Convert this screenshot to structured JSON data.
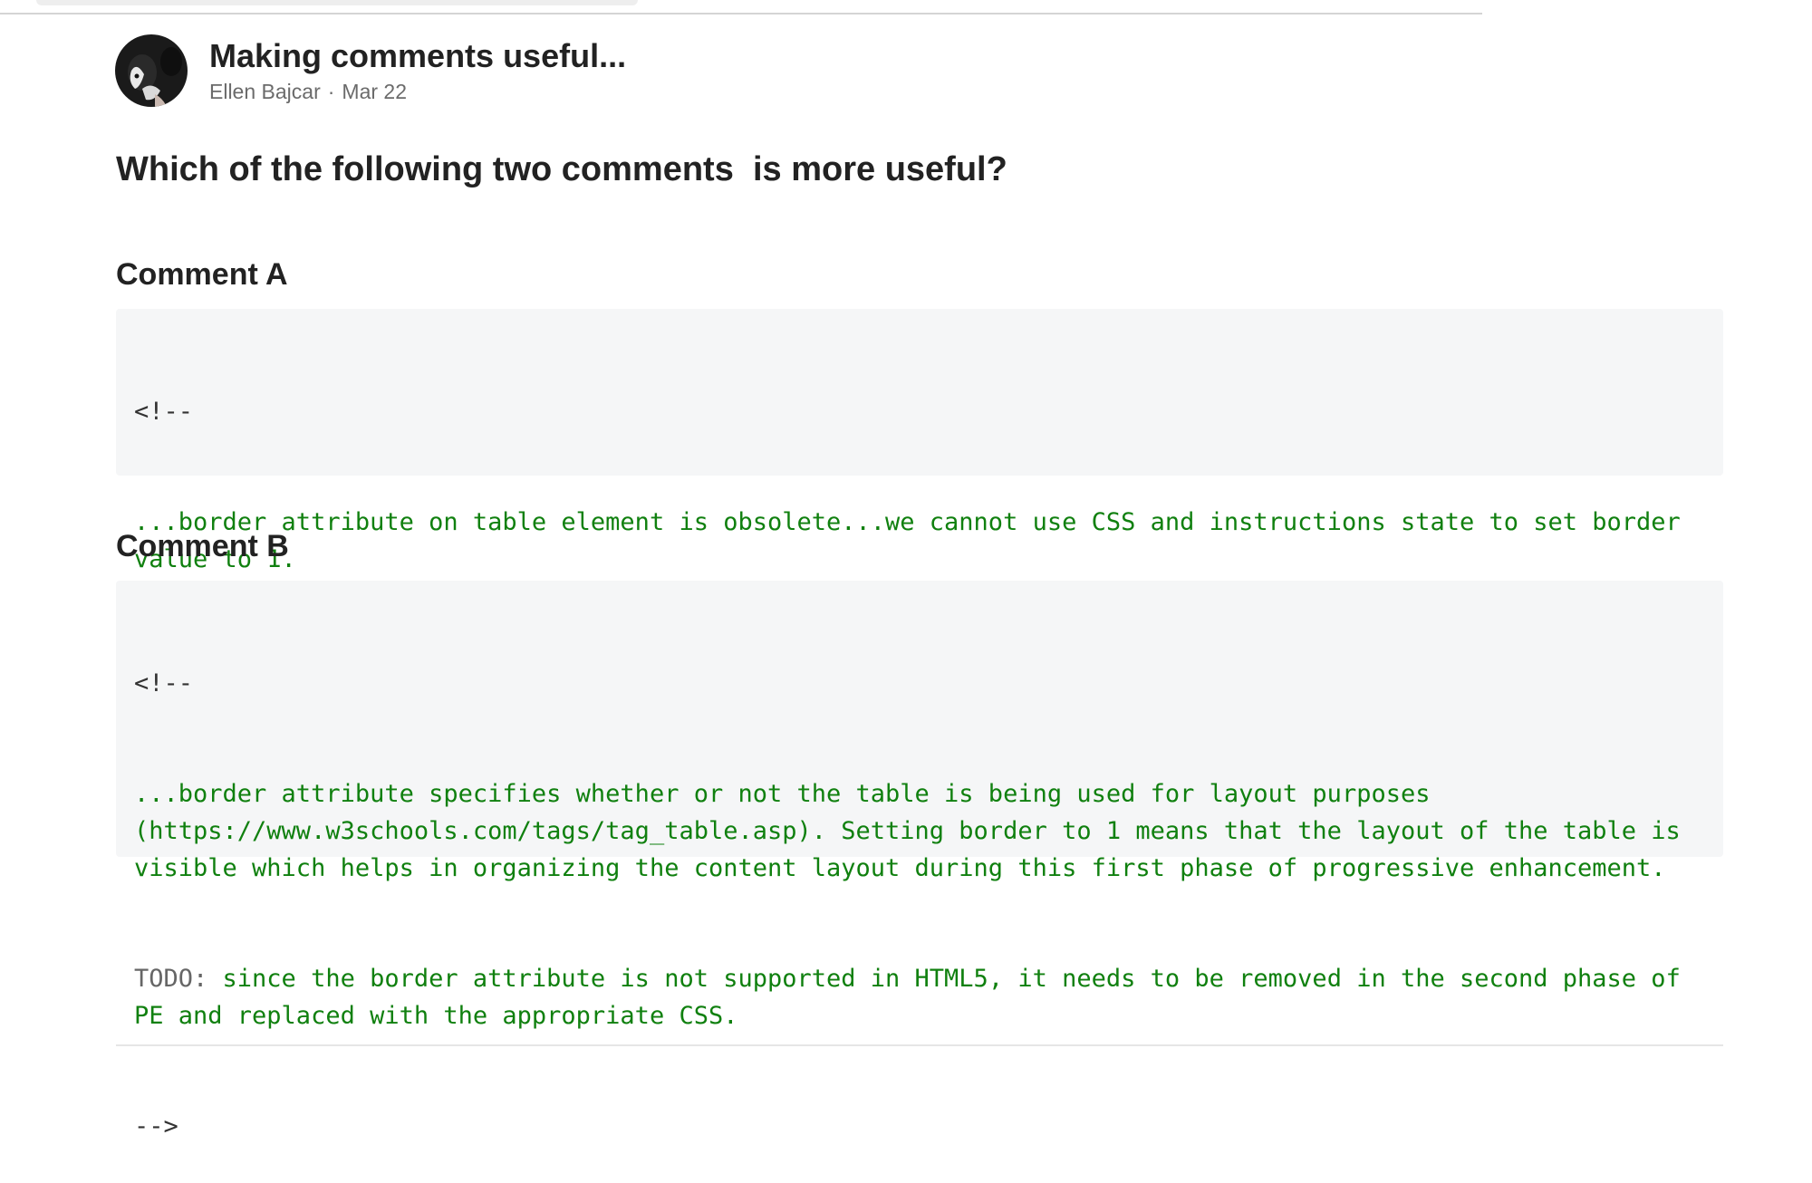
{
  "post": {
    "title": "Making comments useful...",
    "author": "Ellen Bajcar",
    "separator": "·",
    "date": "Mar 22",
    "question": "Which of the following two comments  is more useful?"
  },
  "comment_a": {
    "heading": "Comment A",
    "open": "<!--",
    "body": "...border attribute on table element is obsolete...we cannot use CSS and instructions state to set border value to 1.",
    "close": "-->"
  },
  "comment_b": {
    "heading": "Comment B",
    "open": "<!--",
    "body_1": "...border attribute specifies whether or not the table is being used for layout purposes (https://www.w3schools.com/tags/tag_table.asp). Setting border to 1 means that the layout of the table is visible which helps in organizing the content layout during this first phase of progressive enhancement.",
    "todo_label": "TODO:",
    "body_2": " since the border attribute is not supported in HTML5, it needs to be removed in the second phase of PE and replaced with the appropriate CSS.",
    "close": "-->"
  },
  "colors": {
    "code_green": "#10800f",
    "code_background": "#f5f6f7",
    "meta_gray": "#6b6b6b"
  }
}
